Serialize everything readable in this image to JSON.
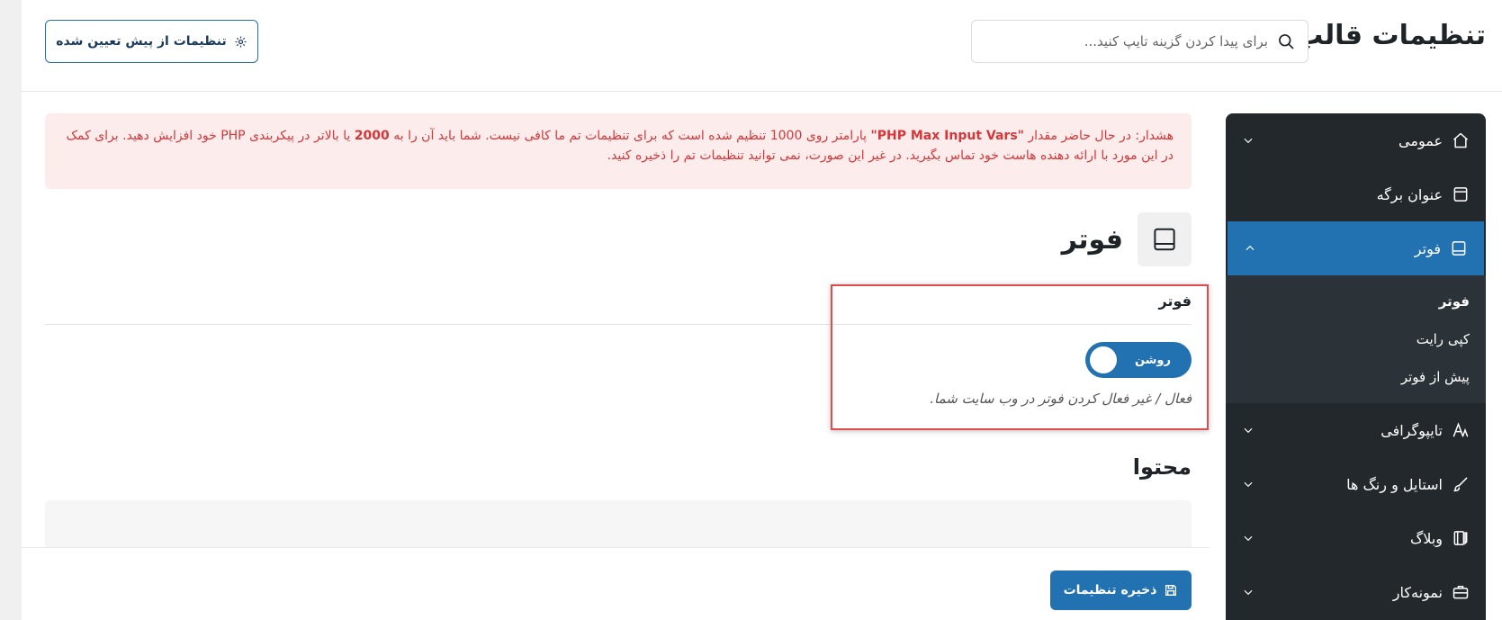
{
  "header": {
    "title": "تنظیمات قالب",
    "search_placeholder": "برای پیدا کردن گزینه تایپ کنید...",
    "preset_button": "تنظیمات از پیش تعیین شده"
  },
  "alert": {
    "part1": "هشدار: در حال حاضر مقدار ",
    "strong1": "\"PHP Max Input Vars\"",
    "part2": " پارامتر روی 1000 تنظیم شده است که برای تنظیمات تم ما کافی نیست. شما باید آن را به ",
    "strong2": "2000",
    "part3": " یا بالاتر در پیکربندی PHP خود افزایش دهید. برای کمک در این مورد با ارائه دهنده هاست خود تماس بگیرید. در غیر این صورت، نمی توانید تنظیمات تم را ذخیره کنید."
  },
  "sidebar": {
    "items": [
      {
        "label": "عمومی",
        "icon": "home-icon"
      },
      {
        "label": "عنوان برگه",
        "icon": "page-title-icon"
      },
      {
        "label": "فوتر",
        "icon": "footer-icon"
      },
      {
        "label": "تایپوگرافی",
        "icon": "typography-icon"
      },
      {
        "label": "استایل و رنگ ها",
        "icon": "brush-icon"
      },
      {
        "label": "وبلاگ",
        "icon": "blog-icon"
      },
      {
        "label": "نمونه‌کار",
        "icon": "briefcase-icon"
      }
    ],
    "submenu": [
      {
        "label": "فوتر"
      },
      {
        "label": "کپی رایت"
      },
      {
        "label": "پیش از فوتر"
      }
    ]
  },
  "section": {
    "title": "فوتر",
    "field_label": "فوتر",
    "toggle_label": "روشن",
    "field_desc": "فعال / غیر فعال کردن فوتر در وب سایت شما.",
    "content_title": "محتوا"
  },
  "save_button": "ذخیره تنظیمات",
  "colors": {
    "primary": "#2271b1",
    "sidebar_bg": "#23282d",
    "alert_bg": "#fdecec",
    "alert_text": "#d63638",
    "highlight": "#e14b4b"
  }
}
